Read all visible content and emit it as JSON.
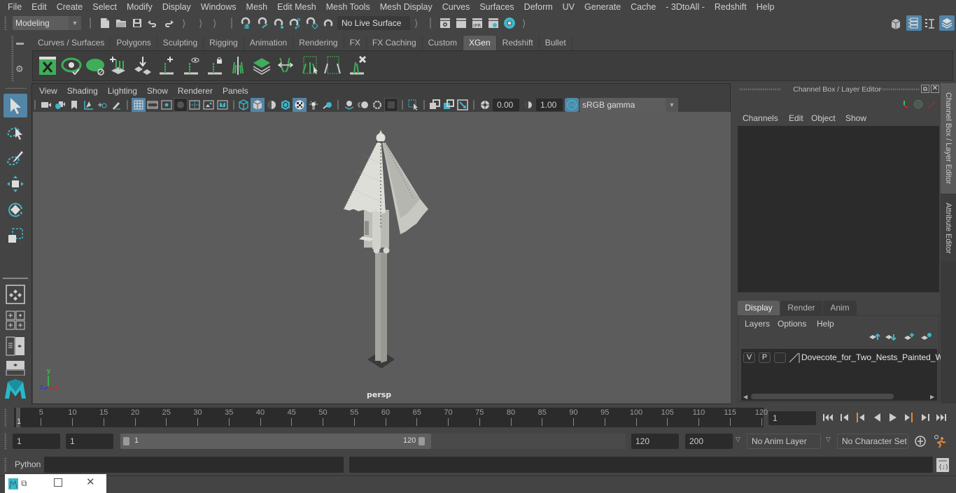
{
  "menubar": {
    "items": [
      "File",
      "Edit",
      "Create",
      "Select",
      "Modify",
      "Display",
      "Windows",
      "Mesh",
      "Edit Mesh",
      "Mesh Tools",
      "Mesh Display",
      "Curves",
      "Surfaces",
      "Deform",
      "UV",
      "Generate",
      "Cache",
      "- 3DtoAll -",
      "Redshift",
      "Help"
    ]
  },
  "statusline": {
    "workspace": "Modeling",
    "live_surface": "No Live Surface"
  },
  "shelf": {
    "tabs": [
      "Curves / Surfaces",
      "Polygons",
      "Sculpting",
      "Rigging",
      "Animation",
      "Rendering",
      "FX",
      "FX Caching",
      "Custom",
      "XGen",
      "Redshift",
      "Bullet"
    ],
    "active_tab": "XGen",
    "icons": [
      "xgen-library-icon",
      "xgen-visibility-icon",
      "xgen-hide-icon",
      "add-guides-icon",
      "place-guides-icon",
      "add-guide-icon",
      "show-guides-icon",
      "lock-guides-icon",
      "split-guides-icon",
      "ground-guides-icon",
      "flip-guides-icon",
      "select-guides-icon",
      "guide-cv-icon",
      "delete-guide-icon"
    ],
    "accent": "#3fae5a"
  },
  "viewport": {
    "menu": [
      "View",
      "Shading",
      "Lighting",
      "Show",
      "Renderer",
      "Panels"
    ],
    "exposure": "0.00",
    "gamma": "1.00",
    "color_space": "sRGB gamma",
    "camera_label": "persp",
    "axis": {
      "x": "x",
      "y": "y",
      "z": "z"
    }
  },
  "channel_box": {
    "title": "Channel Box / Layer Editor",
    "menu": [
      "Channels",
      "Edit",
      "Object",
      "Show"
    ]
  },
  "layer_editor": {
    "tabs": [
      "Display",
      "Render",
      "Anim"
    ],
    "active_tab": "Display",
    "menu": [
      "Layers",
      "Options",
      "Help"
    ],
    "layers": [
      {
        "visible": "V",
        "playback": "P",
        "name": "Dovecote_for_Two_Nests_Painted_Wh"
      }
    ]
  },
  "side_tabs": [
    "Channel Box / Layer Editor",
    "Attribute Editor"
  ],
  "timeline": {
    "ticks": [
      5,
      10,
      15,
      20,
      25,
      30,
      35,
      40,
      45,
      50,
      55,
      60,
      65,
      70,
      75,
      80,
      85,
      90,
      95,
      100,
      105,
      110,
      115,
      120
    ],
    "min": 1,
    "max": 120,
    "current_marker": "1",
    "current_frame": "1"
  },
  "range": {
    "start": "1",
    "playback_start": "1",
    "slider_start": "1",
    "slider_end": "120",
    "playback_end": "120",
    "end": "200",
    "anim_layer": "No Anim Layer",
    "character_set": "No Character Set"
  },
  "cmdline": {
    "label": "Python",
    "value": "",
    "result": ""
  },
  "colors": {
    "accent_blue": "#5285a6",
    "teal": "#3fb6c8",
    "orange": "#e08a3c"
  }
}
